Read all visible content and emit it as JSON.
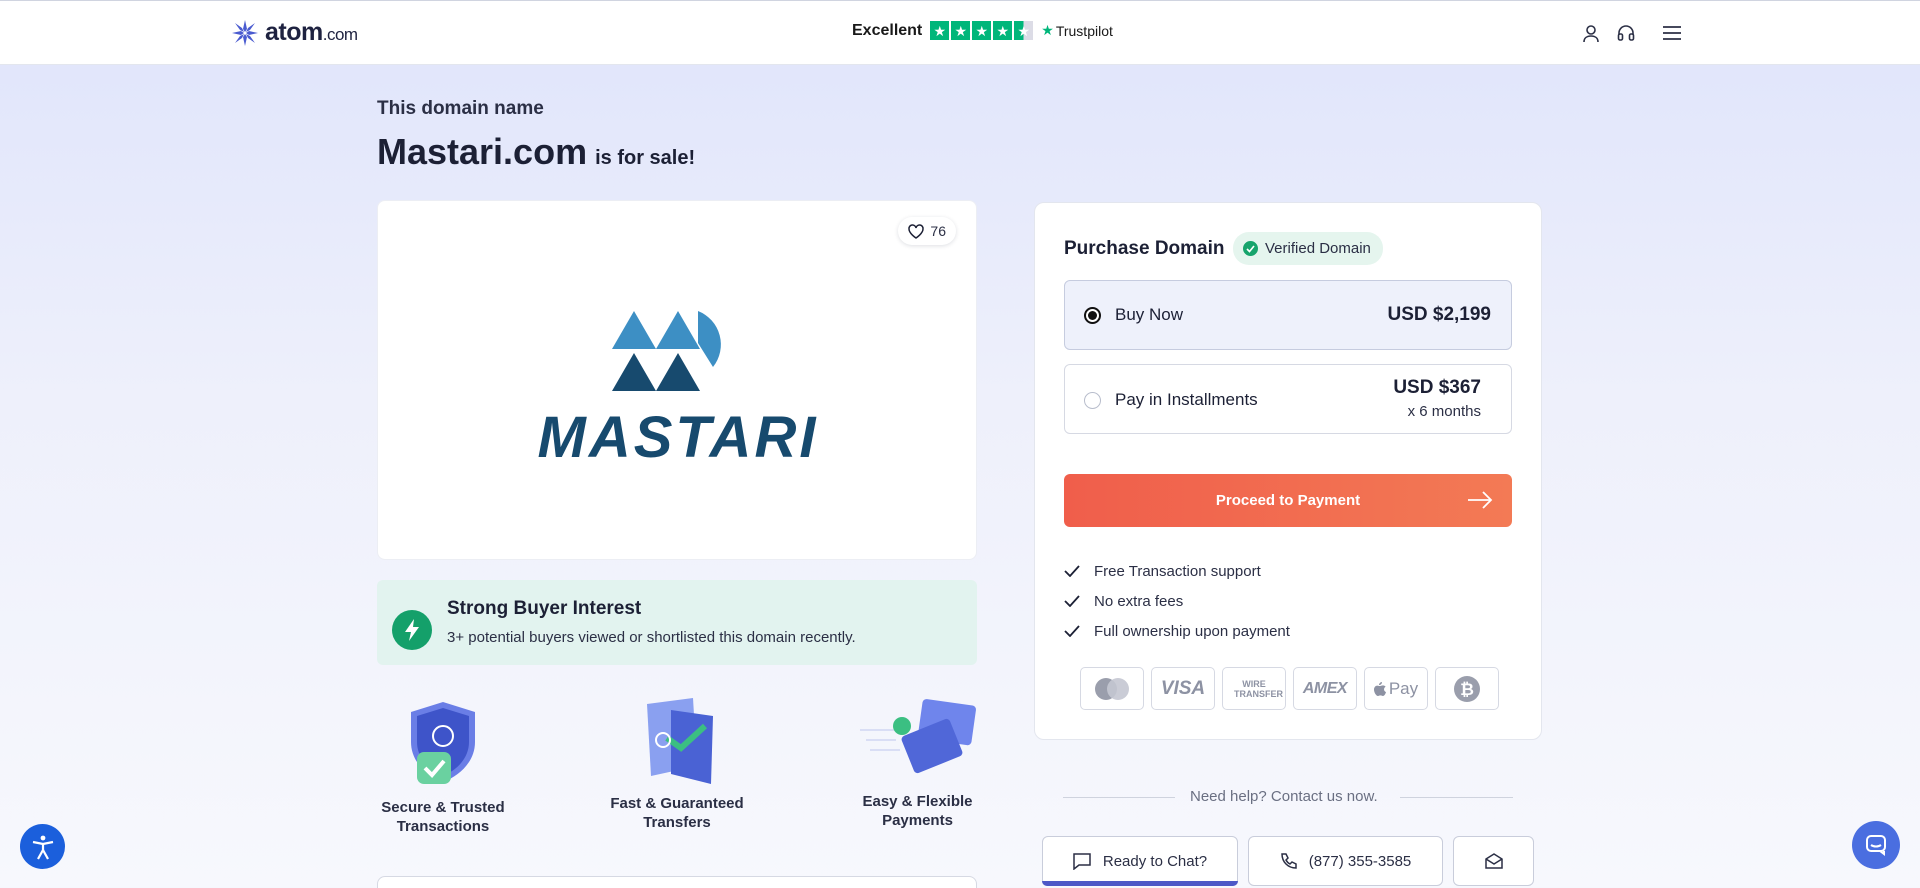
{
  "header": {
    "logo_text": "atom",
    "logo_suffix": ".com",
    "trustpilot_rating_word": "Excellent",
    "trustpilot_brand": "Trustpilot",
    "trustpilot_stars": 4.5,
    "icons": [
      "user-icon",
      "headset-icon",
      "hamburger-menu-icon"
    ]
  },
  "hero": {
    "eyebrow": "This domain name",
    "domain": "Mastari.com",
    "suffix": "is for sale!"
  },
  "logo_card": {
    "like_count": "76",
    "brand_wordmark": "MASTARI"
  },
  "interest": {
    "title": "Strong Buyer Interest",
    "subtitle": "3+ potential buyers viewed or shortlisted this domain recently."
  },
  "features": [
    {
      "line1": "Secure & Trusted",
      "line2": "Transactions"
    },
    {
      "line1": "Fast & Guaranteed",
      "line2": "Transfers"
    },
    {
      "line1": "Easy & Flexible",
      "line2": "Payments"
    }
  ],
  "purchase": {
    "title": "Purchase Domain",
    "verified_label": "Verified Domain",
    "options": [
      {
        "label": "Buy Now",
        "price": "USD $2,199",
        "selected": true
      },
      {
        "label": "Pay in Installments",
        "price": "USD $367",
        "sub": "x 6 months",
        "selected": false
      }
    ],
    "cta": "Proceed to Payment",
    "perks": [
      "Free Transaction support",
      "No extra fees",
      "Full ownership upon payment"
    ],
    "payment_methods": [
      "mastercard-icon",
      "visa-icon",
      "wire-transfer-icon",
      "amex-icon",
      "apple-pay-icon",
      "bitcoin-icon"
    ],
    "payment_labels": {
      "visa": "VISA",
      "wire": "WIRE TRANSFER",
      "amex": "AMEX",
      "applepay": "Pay"
    }
  },
  "help": {
    "text": "Need help? Contact us now.",
    "chat_label": "Ready to Chat?",
    "phone": "(877) 355-3585"
  },
  "colors": {
    "accent": "#f05e4b",
    "success": "#17a46c",
    "brand_dark": "#1b4f73",
    "brand_light": "#3d8fc4"
  }
}
